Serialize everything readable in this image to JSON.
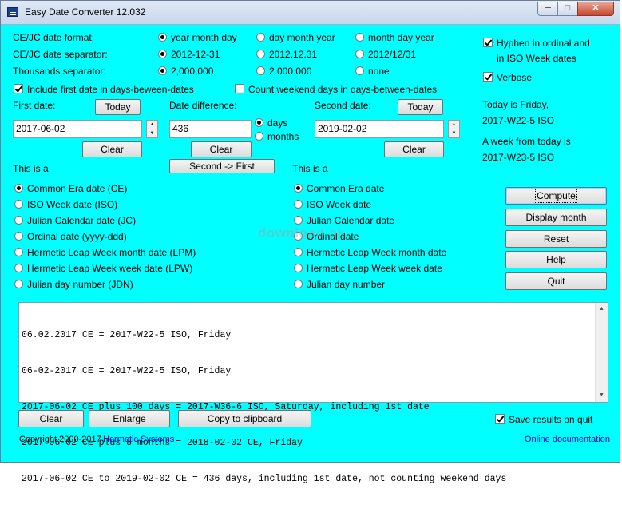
{
  "window": {
    "title": "Easy Date Converter 12.032"
  },
  "format": {
    "date_format_label": "CE/JC date format:",
    "date_format_options": [
      "year month day",
      "day month year",
      "month day year"
    ],
    "separator_label": "CE/JC date separator:",
    "separator_options": [
      "2012-12-31",
      "2012.12.31",
      "2012/12/31"
    ],
    "thousands_label": "Thousands separator:",
    "thousands_options": [
      "2,000,000",
      "2.000.000",
      "none"
    ]
  },
  "options": {
    "hyphen_line1": "Hyphen in ordinal and",
    "hyphen_line2": "in ISO Week dates",
    "verbose": "Verbose",
    "include_first": "Include first date in days-beween-dates",
    "count_weekend": "Count weekend days in days-between-dates"
  },
  "first": {
    "label": "First date:",
    "today": "Today",
    "value": "2017-06-02",
    "clear": "Clear",
    "this_is": "This is a",
    "types": [
      "Common Era date (CE)",
      "ISO Week date (ISO)",
      "Julian Calendar date (JC)",
      "Ordinal date (yyyy-ddd)",
      "Hermetic Leap Week month date (LPM)",
      "Hermetic Leap Week week date (LPW)",
      "Julian day number (JDN)"
    ]
  },
  "diff": {
    "label": "Date difference:",
    "value": "436",
    "days": "days",
    "months": "months",
    "clear": "Clear",
    "second_first": "Second -> First"
  },
  "second": {
    "label": "Second date:",
    "today": "Today",
    "value": "2019-02-02",
    "clear": "Clear",
    "this_is": "This is a",
    "types": [
      "Common Era date",
      "ISO Week date",
      "Julian Calendar date",
      "Ordinal date",
      "Hermetic Leap Week month date",
      "Hermetic Leap Week week date",
      "Julian day number"
    ]
  },
  "info": {
    "today_line1": "Today is Friday,",
    "today_line2": "2017-W22-5 ISO",
    "week_line1": "A week from today is",
    "week_line2": "2017-W23-5 ISO"
  },
  "actions": {
    "compute": "Compute",
    "display_month": "Display month",
    "reset": "Reset",
    "help": "Help",
    "quit": "Quit"
  },
  "output": {
    "lines": [
      "06.02.2017 CE = 2017-W22-5 ISO, Friday",
      "06-02-2017 CE = 2017-W22-5 ISO, Friday",
      "2017-06-02 CE plus 100 days = 2017-W36-6 ISO, Saturday, including 1st date",
      "2017-06-02 CE plus 8 months = 2018-02-02 CE, Friday",
      "2017-06-02 CE to 2019-02-02 CE = 436 days, including 1st date, not counting weekend days"
    ]
  },
  "bottom": {
    "clear": "Clear",
    "enlarge": "Enlarge",
    "copy": "Copy to clipboard",
    "save_results": "Save results on quit",
    "copyright": "Copyright 2000-2017",
    "company": "Hermetic Systems",
    "online_doc": "Online documentation"
  },
  "watermark": "download.ok"
}
